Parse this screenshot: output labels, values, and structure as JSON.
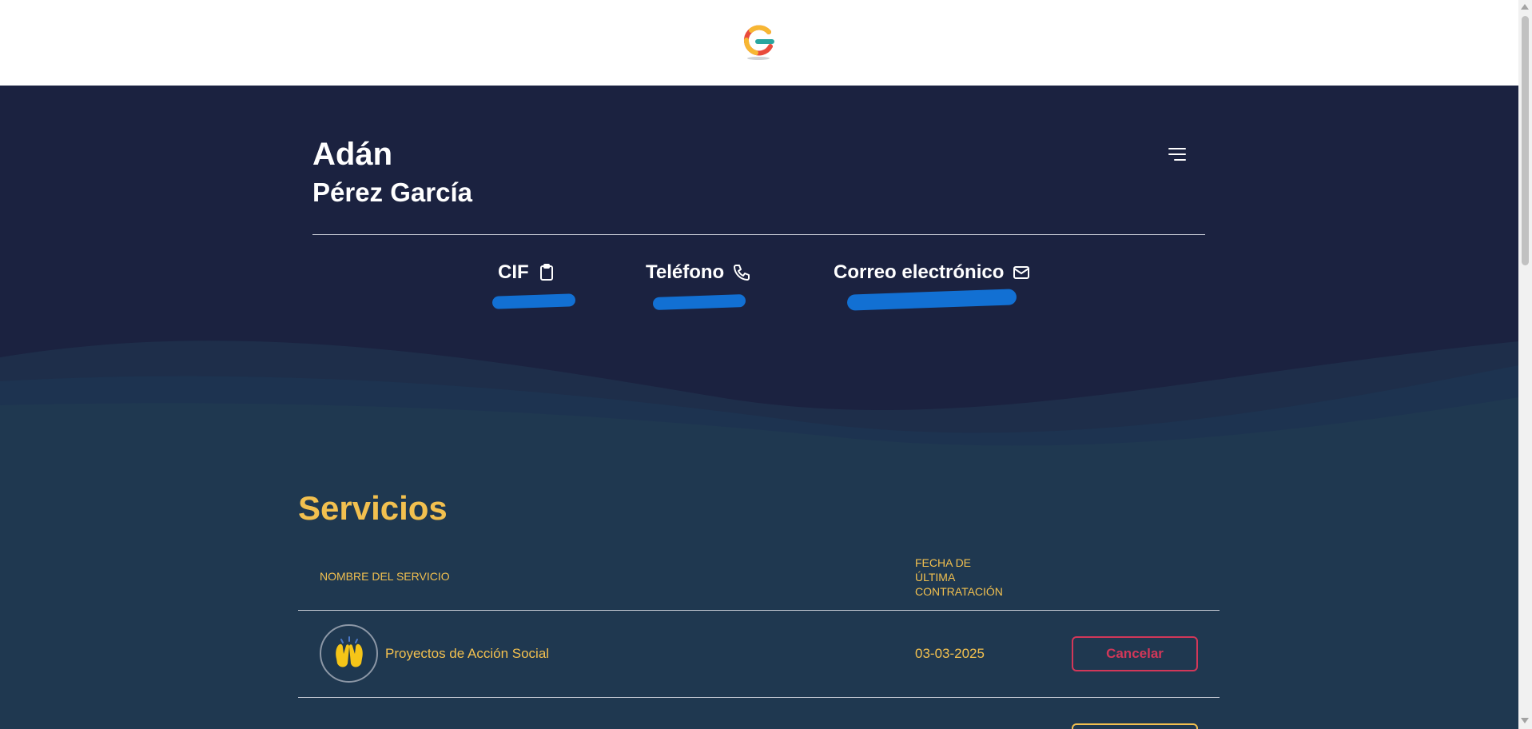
{
  "header": {
    "logo_icon": "brand-logo-icon"
  },
  "profile": {
    "first_name": "Adán",
    "last_name": "Pérez García",
    "menu_icon": "menu-icon"
  },
  "contact": {
    "cif_label": "CIF",
    "phone_label": "Teléfono",
    "email_label": "Correo electrónico"
  },
  "services": {
    "title": "Servicios",
    "col_name": "NOMBRE DEL SERVICIO",
    "col_date": "FECHA DE ÚLTIMA CONTRATACIÓN",
    "rows": [
      {
        "icon": "raised-hands-icon",
        "name": "Proyectos de Acción Social",
        "date": "03-03-2025",
        "action": "Cancelar"
      }
    ]
  },
  "colors": {
    "navy": "#1b2240",
    "teal": "#1f3850",
    "accent": "#f2c04f",
    "danger": "#d23759"
  }
}
